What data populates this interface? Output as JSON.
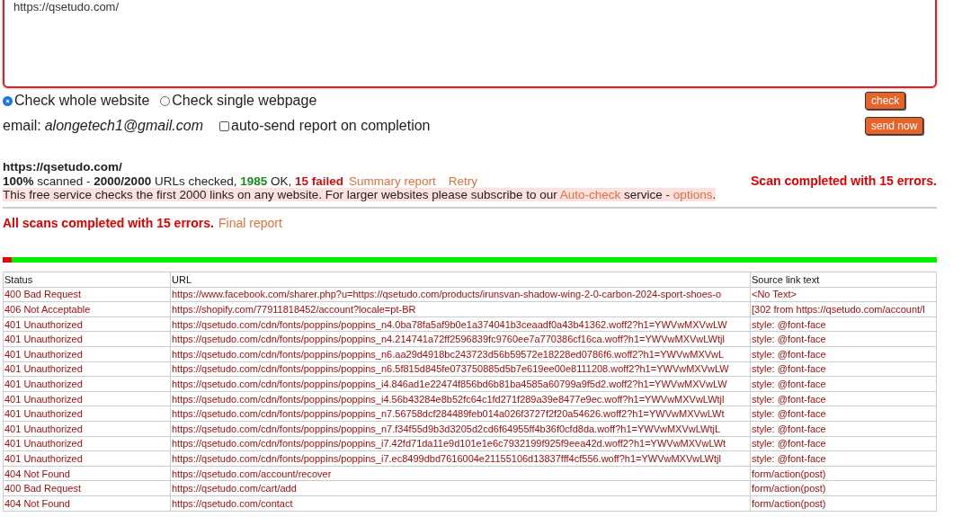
{
  "url_input": {
    "value": "https://qsetudo.com/"
  },
  "scan_mode": [
    {
      "label": "Check whole website",
      "selected": true
    },
    {
      "label": "Check single webpage",
      "selected": false
    }
  ],
  "check_button": "check",
  "email": {
    "label": "email:",
    "value": "alongetech1@gmail.com"
  },
  "auto_send": {
    "label": "auto-send report on completion",
    "checked": false
  },
  "send_button": "send now",
  "site": {
    "url": "https://qsetudo.com/",
    "status_parts": [
      {
        "text": "100%",
        "kind": "bold"
      },
      {
        "text": " scanned - ",
        "kind": "plain"
      },
      {
        "text": "2000/2000",
        "kind": "bold"
      },
      {
        "text": " URLs checked, ",
        "kind": "plain"
      },
      {
        "text": "1985",
        "kind": "ok"
      },
      {
        "text": " OK, ",
        "kind": "plain"
      },
      {
        "text": "15 failed",
        "kind": "fail"
      }
    ],
    "summary_link": "Summary report",
    "retry_link": "Retry",
    "scan_result": "Scan completed with 15 errors.",
    "notice": {
      "before": "This free service checks the first 2000 links on any website. For larger websites please subscribe to our ",
      "link": "Auto-check",
      "middle": " service - ",
      "link2": "options",
      "after": "."
    }
  },
  "all_scans": {
    "text": "All scans completed with 15 errors.",
    "link": "Final report"
  },
  "progress": {
    "level": 0.01
  },
  "table": {
    "columns": [
      "Status",
      "URL",
      "Source link text"
    ],
    "rows": [
      [
        "400 Bad Request",
        "https://www.facebook.com/sharer.php?u=https://qsetudo.com/products/irunsvan-shadow-wing-2-0-carbon-2024-sport-shoes-o",
        "<No Text>"
      ],
      [
        "406 Not Acceptable",
        "https://shopify.com/77911818452/account?locale=pt-BR",
        "[302 from https://qsetudo.com/account/l"
      ],
      [
        "401 Unauthorized",
        "https://qsetudo.com/cdn/fonts/poppins/poppins_n4.0ba78fa5af9b0e1a374041b3ceaadf0a43b41362.woff2?h1=YWVwMXVwLW",
        "style: @font-face"
      ],
      [
        "401 Unauthorized",
        "https://qsetudo.com/cdn/fonts/poppins/poppins_n4.214741a72ff2596839fc9760ee7a770386cf16ca.woff?h1=YWVwMXVwLWtjl",
        "style: @font-face"
      ],
      [
        "401 Unauthorized",
        "https://qsetudo.com/cdn/fonts/poppins/poppins_n6.aa29d4918bc243723d56b59572e18228ed0786f6.woff2?h1=YWVwMXVwL",
        "style: @font-face"
      ],
      [
        "401 Unauthorized",
        "https://qsetudo.com/cdn/fonts/poppins/poppins_n6.5f815d845fe073750885d5b7e619ee00e8111208.woff2?h1=YWVwMXVwLW",
        "style: @font-face"
      ],
      [
        "401 Unauthorized",
        "https://qsetudo.com/cdn/fonts/poppins/poppins_i4.846ad1e22474f856bd6b81ba4585a60799a9f5d2.woff2?h1=YWVwMXVwLW",
        "style: @font-face"
      ],
      [
        "401 Unauthorized",
        "https://qsetudo.com/cdn/fonts/poppins/poppins_i4.56b43284e8b52fc64c1fd271f289a39e8477e9ec.woff?h1=YWVwMXVwLWtjl",
        "style: @font-face"
      ],
      [
        "401 Unauthorized",
        "https://qsetudo.com/cdn/fonts/poppins/poppins_n7.56758dcf284489feb014a026f3727f2f20a54626.woff2?h1=YWVwMXVwLWt",
        "style: @font-face"
      ],
      [
        "401 Unauthorized",
        "https://qsetudo.com/cdn/fonts/poppins/poppins_n7.f34f55d9b3d3205d2cd6f64955ff4b36f0cfd8da.woff?h1=YWVwMXVwLWtjL",
        "style: @font-face"
      ],
      [
        "401 Unauthorized",
        "https://qsetudo.com/cdn/fonts/poppins/poppins_i7.42fd71da11e9d101e1e6c7932199f925f9eea42d.woff2?h1=YWVwMXVwLWt",
        "style: @font-face"
      ],
      [
        "401 Unauthorized",
        "https://qsetudo.com/cdn/fonts/poppins/poppins_i7.ec8499dbd7616004e21155106d13837fff4cf556.woff?h1=YWVwMXVwLWtjl",
        "style: @font-face"
      ],
      [
        "404 Not Found",
        "https://qsetudo.com/account/recover",
        "form/action(post)"
      ],
      [
        "400 Bad Request",
        "https://qsetudo.com/cart/add",
        "form/action(post)"
      ],
      [
        "404 Not Found",
        "https://qsetudo.com/contact",
        "form/action(post)"
      ]
    ]
  }
}
